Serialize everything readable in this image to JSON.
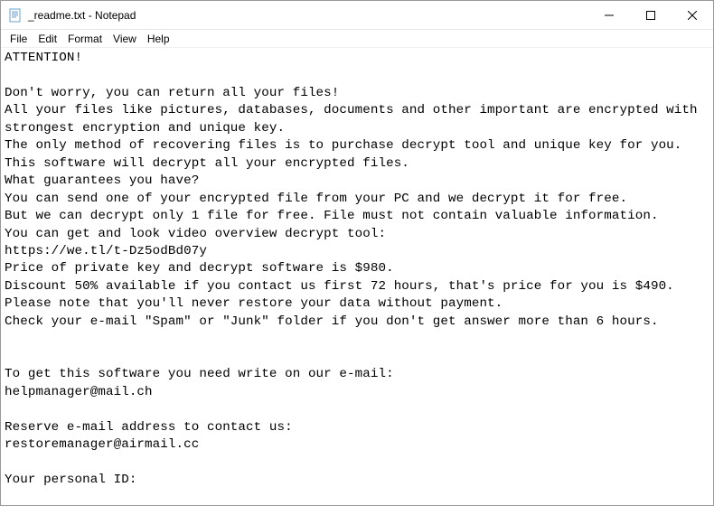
{
  "titlebar": {
    "title": "_readme.txt - Notepad"
  },
  "menu": {
    "file": "File",
    "edit": "Edit",
    "format": "Format",
    "view": "View",
    "help": "Help"
  },
  "body": "ATTENTION!\n\nDon't worry, you can return all your files!\nAll your files like pictures, databases, documents and other important are encrypted with strongest encryption and unique key.\nThe only method of recovering files is to purchase decrypt tool and unique key for you.\nThis software will decrypt all your encrypted files.\nWhat guarantees you have?\nYou can send one of your encrypted file from your PC and we decrypt it for free.\nBut we can decrypt only 1 file for free. File must not contain valuable information.\nYou can get and look video overview decrypt tool:\nhttps://we.tl/t-Dz5odBd07y\nPrice of private key and decrypt software is $980.\nDiscount 50% available if you contact us first 72 hours, that's price for you is $490.\nPlease note that you'll never restore your data without payment.\nCheck your e-mail \"Spam\" or \"Junk\" folder if you don't get answer more than 6 hours.\n\n\nTo get this software you need write on our e-mail:\nhelpmanager@mail.ch\n\nReserve e-mail address to contact us:\nrestoremanager@airmail.cc\n\nYour personal ID:"
}
